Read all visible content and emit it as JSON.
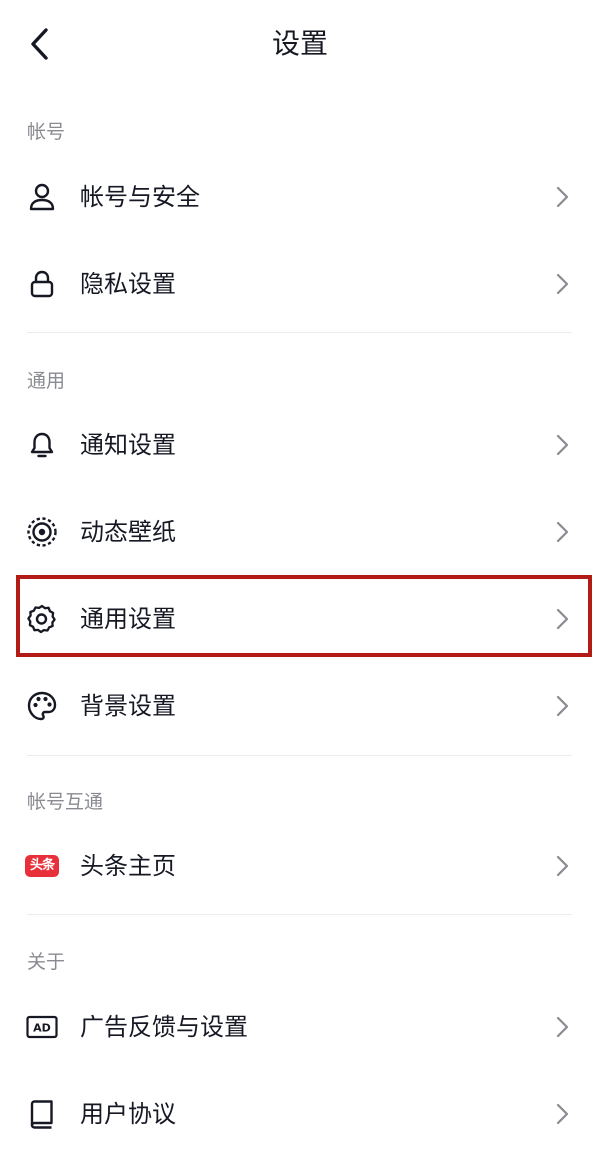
{
  "header": {
    "title": "设置",
    "back_icon": "chevron-left-icon"
  },
  "sections": [
    {
      "label": "帐号",
      "items": [
        {
          "label": "帐号与安全",
          "icon": "user-icon"
        },
        {
          "label": "隐私设置",
          "icon": "lock-icon"
        }
      ]
    },
    {
      "label": "通用",
      "items": [
        {
          "label": "通知设置",
          "icon": "bell-icon"
        },
        {
          "label": "动态壁纸",
          "icon": "live-wallpaper-icon"
        },
        {
          "label": "通用设置",
          "icon": "gear-icon",
          "highlighted": true
        },
        {
          "label": "背景设置",
          "icon": "palette-icon"
        }
      ]
    },
    {
      "label": "帐号互通",
      "items": [
        {
          "label": "头条主页",
          "icon": "toutiao-logo-icon",
          "badge_text": "头条"
        }
      ]
    },
    {
      "label": "关于",
      "items": [
        {
          "label": "广告反馈与设置",
          "icon": "ad-icon",
          "icon_text": "AD"
        },
        {
          "label": "用户协议",
          "icon": "book-icon"
        }
      ]
    }
  ],
  "colors": {
    "text_primary": "#161823",
    "text_secondary": "#8a8b91",
    "chevron": "#8a8b91",
    "divider": "#ececee",
    "highlight_border": "#b31b17",
    "toutiao_red": "#e8303b"
  }
}
